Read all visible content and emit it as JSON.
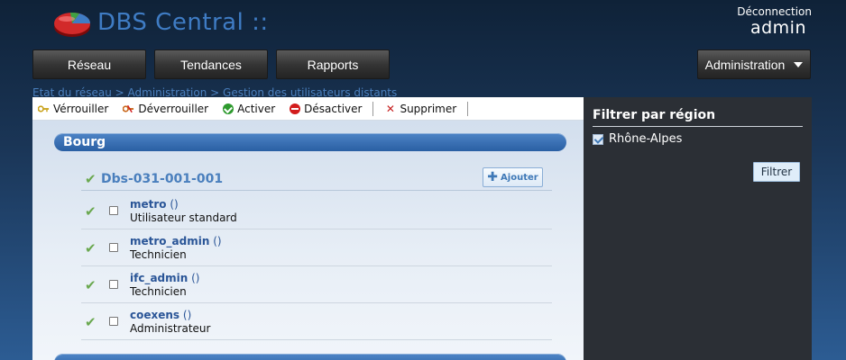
{
  "header": {
    "app_title": "DBS Central ::",
    "logout_label": "Déconnection",
    "username": "admin"
  },
  "nav": {
    "items": [
      {
        "label": "Réseau"
      },
      {
        "label": "Tendances"
      },
      {
        "label": "Rapports"
      }
    ],
    "admin_label": "Administration"
  },
  "breadcrumb": "Etat du réseau > Administration > Gestion des utilisateurs distants",
  "toolbar": {
    "lock_label": "Vérrouiller",
    "unlock_label": "Déverrouiller",
    "activate_label": "Activer",
    "deactivate_label": "Désactiver",
    "delete_label": "Supprimer"
  },
  "groups": [
    {
      "name": "Bourg",
      "site": {
        "name": "Dbs-031-001-001",
        "add_label": "Ajouter"
      },
      "users": [
        {
          "login": "metro",
          "extra": "()",
          "role": "Utilisateur standard"
        },
        {
          "login": "metro_admin",
          "extra": "()",
          "role": "Technicien"
        },
        {
          "login": "ifc_admin",
          "extra": "()",
          "role": "Technicien"
        },
        {
          "login": "coexens",
          "extra": "()",
          "role": "Administrateur"
        }
      ]
    }
  ],
  "sidebar": {
    "title": "Filtrer par région",
    "region_label": "Rhône-Alpes",
    "filter_button": "Filtrer"
  },
  "colors": {
    "accent": "#3f7cc4",
    "group_header": "#2a5fa3",
    "sidebar_bg": "#2b2f35"
  }
}
